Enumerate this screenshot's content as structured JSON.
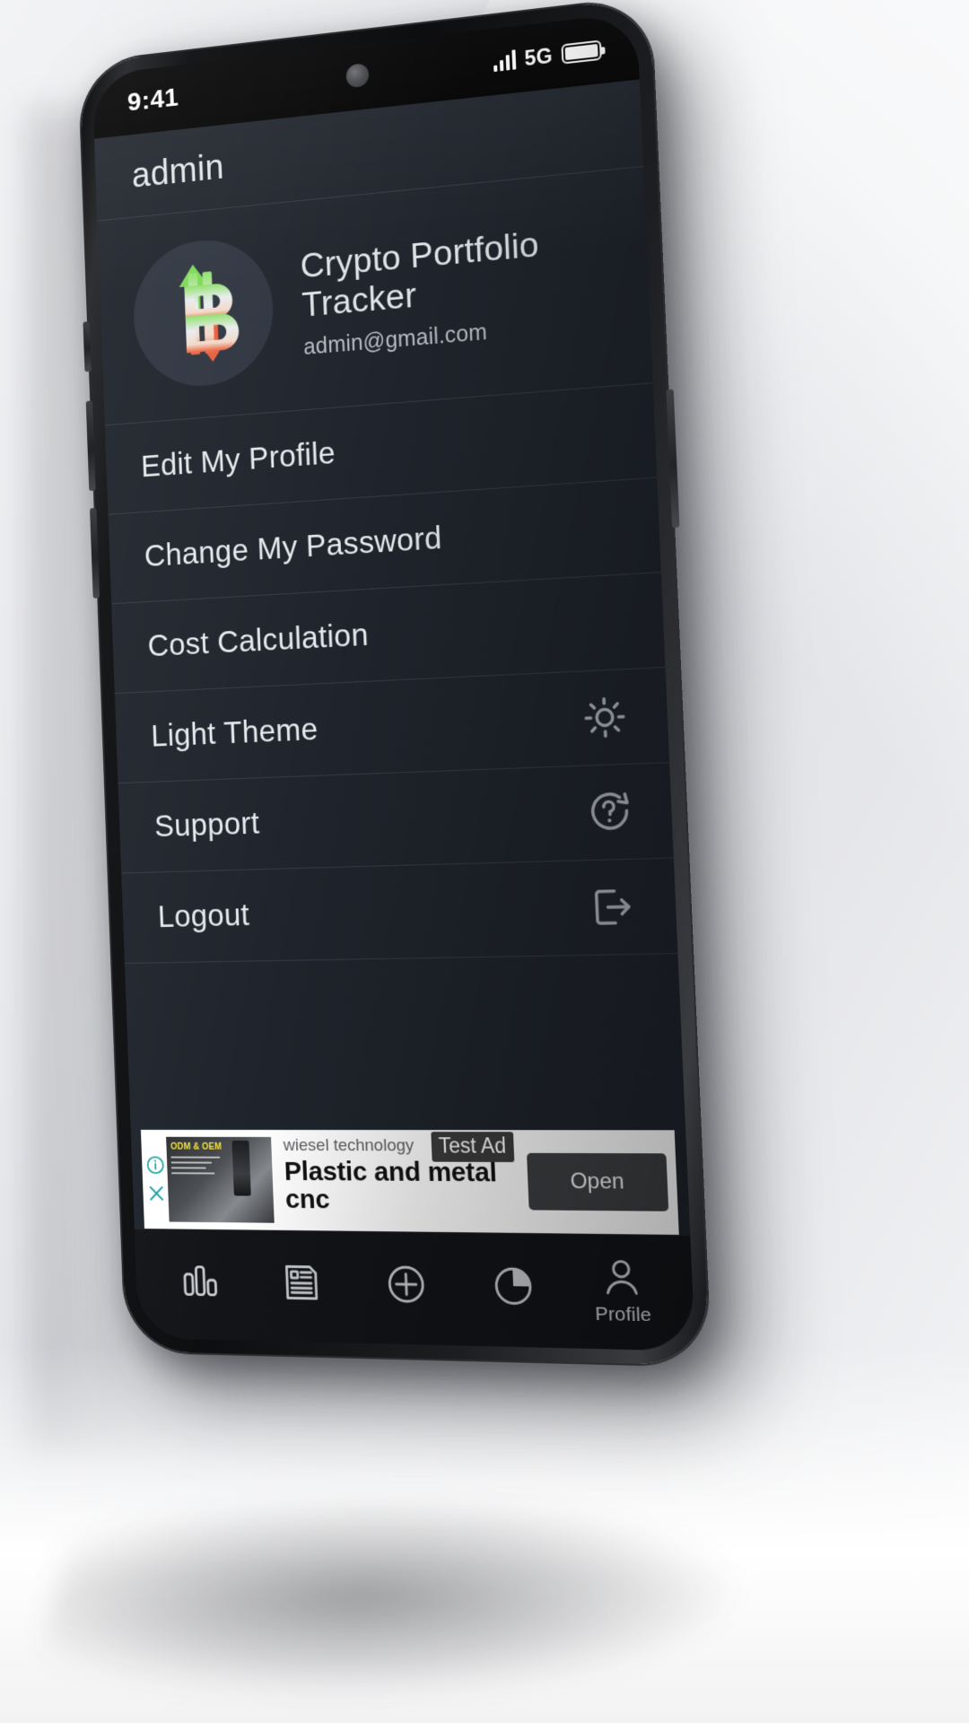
{
  "status_bar": {
    "time": "9:41",
    "network": "5G",
    "signal_icon": "signal-bars-icon",
    "battery_icon": "battery-full-icon"
  },
  "app_bar": {
    "title": "admin"
  },
  "profile": {
    "avatar_icon": "bitcoin-up-down-arrows-logo",
    "app_name": "Crypto Portfolio Tracker",
    "email": "admin@gmail.com"
  },
  "menu": {
    "items": [
      {
        "label": "Edit My Profile",
        "icon": "",
        "name": "edit-my-profile"
      },
      {
        "label": "Change My Password",
        "icon": "",
        "name": "change-my-password"
      },
      {
        "label": "Cost Calculation",
        "icon": "",
        "name": "cost-calculation"
      },
      {
        "label": "Light Theme",
        "icon": "sun-icon",
        "name": "light-theme"
      },
      {
        "label": "Support",
        "icon": "question-mark-speech-bubble-icon",
        "name": "support"
      },
      {
        "label": "Logout",
        "icon": "logout-arrow-icon",
        "name": "logout"
      }
    ]
  },
  "ad": {
    "advertiser": "wiesel technology",
    "badge": "Test Ad",
    "headline": "Plastic and metal cnc",
    "cta_label": "Open",
    "thumb_tag": "ODM & OEM",
    "info_icon": "info-icon",
    "close_icon": "close-icon",
    "accent_color": "#1aa3a3"
  },
  "bottom_nav": {
    "items": [
      {
        "label": "",
        "icon": "bar-chart-icon",
        "name": "nav-markets",
        "active": false
      },
      {
        "label": "",
        "icon": "news-document-icon",
        "name": "nav-news",
        "active": false
      },
      {
        "label": "",
        "icon": "plus-circle-icon",
        "name": "nav-add",
        "active": false
      },
      {
        "label": "",
        "icon": "pie-chart-icon",
        "name": "nav-portfolio",
        "active": false
      },
      {
        "label": "Profile",
        "icon": "person-icon",
        "name": "nav-profile",
        "active": true
      }
    ]
  },
  "colors": {
    "screen_bg": "#1f242c",
    "divider": "#343a44",
    "nav_bg": "#121418",
    "text_primary": "#e6e9ec",
    "text_secondary": "#b6bcc4",
    "arrow_up": "#7ed957",
    "arrow_down": "#e8603c"
  }
}
